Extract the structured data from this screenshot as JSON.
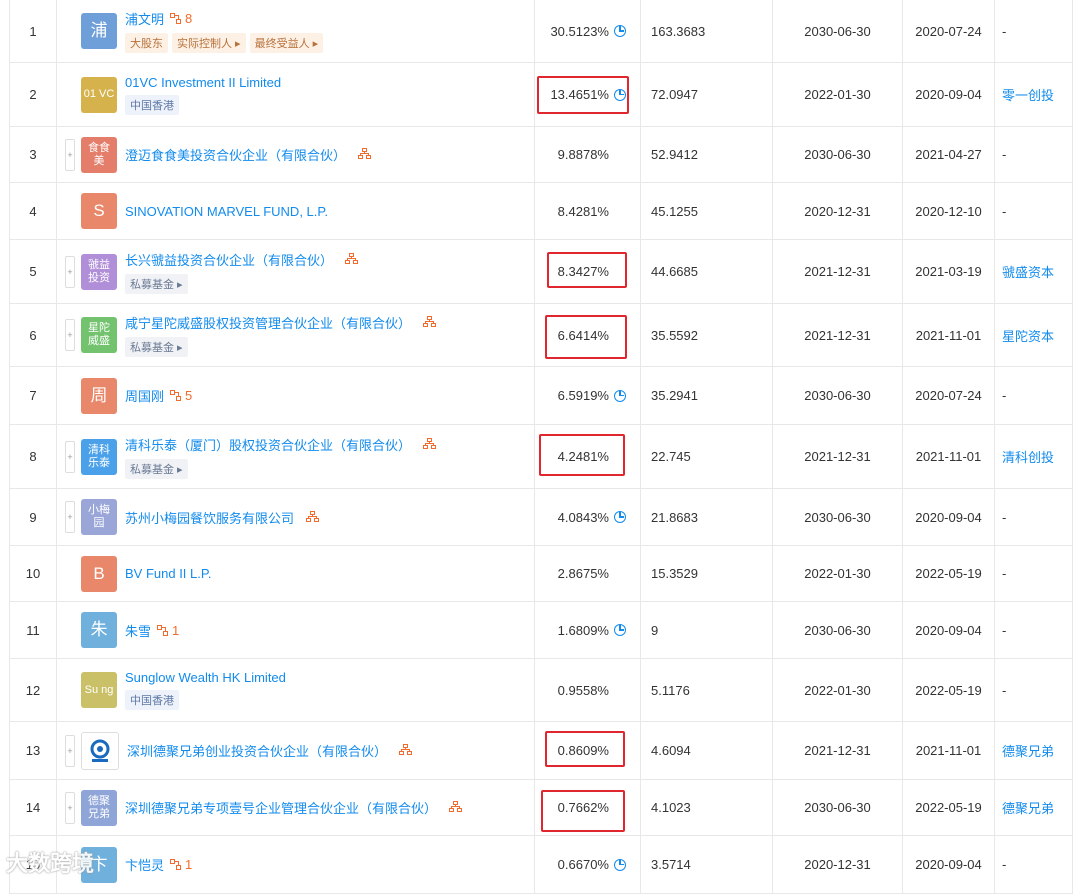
{
  "rows": [
    {
      "idx": "1",
      "logo": "浦",
      "logo_color": "#6f9fd8",
      "name": "浦文明",
      "count": "8",
      "tags": [
        {
          "t": "大股东",
          "c": "orange"
        },
        {
          "t": "实际控制人 ▸",
          "c": "orange"
        },
        {
          "t": "最终受益人 ▸",
          "c": "orange"
        }
      ],
      "pct": "30.5123%",
      "pie": true,
      "amt": "163.3683",
      "d1": "2030-06-30",
      "d2": "2020-07-24",
      "brand": "-",
      "expand": false,
      "tree": false,
      "hl": false
    },
    {
      "idx": "2",
      "logo": "01 VC",
      "logo_color": "#d6b24d",
      "name": "01VC Investment II Limited",
      "tags": [
        {
          "t": "中国香港",
          "c": "blue"
        }
      ],
      "pct": "13.4651%",
      "pie": true,
      "amt": "72.0947",
      "d1": "2022-01-30",
      "d2": "2020-09-04",
      "brand": "零一创投",
      "expand": false,
      "tree": false,
      "hl": true
    },
    {
      "idx": "3",
      "logo": "食食 美",
      "logo_color": "#e47d6a",
      "name": "澄迈食食美投资合伙企业（有限合伙）",
      "tags": [],
      "pct": "9.8878%",
      "pie": false,
      "amt": "52.9412",
      "d1": "2030-06-30",
      "d2": "2021-04-27",
      "brand": "-",
      "expand": true,
      "tree": true,
      "hl": false
    },
    {
      "idx": "4",
      "logo": "S",
      "logo_color": "#e8876a",
      "name": "SINOVATION MARVEL FUND, L.P.",
      "tags": [],
      "pct": "8.4281%",
      "pie": false,
      "amt": "45.1255",
      "d1": "2020-12-31",
      "d2": "2020-12-10",
      "brand": "-",
      "expand": false,
      "tree": false,
      "hl": false
    },
    {
      "idx": "5",
      "logo": "虢益 投资",
      "logo_color": "#b08fd8",
      "name": "长兴虢益投资合伙企业（有限合伙）",
      "tags": [
        {
          "t": "私募基金 ▸",
          "c": "gray"
        }
      ],
      "pct": "8.3427%",
      "pie": false,
      "amt": "44.6685",
      "d1": "2021-12-31",
      "d2": "2021-03-19",
      "brand": "虢盛资本",
      "expand": true,
      "tree": true,
      "hl": true
    },
    {
      "idx": "6",
      "logo": "星陀 威盛",
      "logo_color": "#72c26e",
      "name": "咸宁星陀威盛股权投资管理合伙企业（有限合伙）",
      "tags": [
        {
          "t": "私募基金 ▸",
          "c": "gray"
        }
      ],
      "pct": "6.6414%",
      "pie": false,
      "amt": "35.5592",
      "d1": "2021-12-31",
      "d2": "2021-11-01",
      "brand": "星陀资本",
      "expand": true,
      "tree": true,
      "hl": true
    },
    {
      "idx": "7",
      "logo": "周",
      "logo_color": "#e8876a",
      "name": "周国刚",
      "count": "5",
      "tags": [],
      "pct": "6.5919%",
      "pie": true,
      "amt": "35.2941",
      "d1": "2030-06-30",
      "d2": "2020-07-24",
      "brand": "-",
      "expand": false,
      "tree": false,
      "hl": false
    },
    {
      "idx": "8",
      "logo": "清科 乐泰",
      "logo_color": "#4aa1ea",
      "name": "清科乐泰（厦门）股权投资合伙企业（有限合伙）",
      "tags": [
        {
          "t": "私募基金 ▸",
          "c": "gray"
        }
      ],
      "pct": "4.2481%",
      "pie": false,
      "amt": "22.745",
      "d1": "2021-12-31",
      "d2": "2021-11-01",
      "brand": "清科创投",
      "expand": true,
      "tree": true,
      "hl": true
    },
    {
      "idx": "9",
      "logo": "小梅 园",
      "logo_color": "#9aa6d8",
      "name": "苏州小梅园餐饮服务有限公司",
      "tags": [],
      "pct": "4.0843%",
      "pie": true,
      "amt": "21.8683",
      "d1": "2030-06-30",
      "d2": "2020-09-04",
      "brand": "-",
      "expand": true,
      "tree": true,
      "hl": false
    },
    {
      "idx": "10",
      "logo": "B",
      "logo_color": "#e8876a",
      "name": "BV Fund II L.P.",
      "tags": [],
      "pct": "2.8675%",
      "pie": false,
      "amt": "15.3529",
      "d1": "2022-01-30",
      "d2": "2022-05-19",
      "brand": "-",
      "expand": false,
      "tree": false,
      "hl": false
    },
    {
      "idx": "11",
      "logo": "朱",
      "logo_color": "#6fb0dc",
      "name": "朱雪",
      "count": "1",
      "tags": [],
      "pct": "1.6809%",
      "pie": true,
      "amt": "9",
      "d1": "2030-06-30",
      "d2": "2020-09-04",
      "brand": "-",
      "expand": false,
      "tree": false,
      "hl": false
    },
    {
      "idx": "12",
      "logo": "Su ng",
      "logo_color": "#c9c067",
      "name": "Sunglow Wealth HK Limited",
      "tags": [
        {
          "t": "中国香港",
          "c": "blue"
        }
      ],
      "pct": "0.9558%",
      "pie": false,
      "amt": "5.1176",
      "d1": "2022-01-30",
      "d2": "2022-05-19",
      "brand": "-",
      "expand": false,
      "tree": false,
      "hl": false
    },
    {
      "idx": "13",
      "logo": "@",
      "logo_color": "#ffffff",
      "name": "深圳德聚兄弟创业投资合伙企业（有限合伙）",
      "tags": [],
      "pct": "0.8609%",
      "pie": false,
      "amt": "4.6094",
      "d1": "2021-12-31",
      "d2": "2021-11-01",
      "brand": "德聚兄弟",
      "expand": true,
      "tree": true,
      "hl": true
    },
    {
      "idx": "14",
      "logo": "德聚 兄弟",
      "logo_color": "#8fa5d8",
      "name": "深圳德聚兄弟专项壹号企业管理合伙企业（有限合伙）",
      "tags": [],
      "pct": "0.7662%",
      "pie": false,
      "amt": "4.1023",
      "d1": "2030-06-30",
      "d2": "2022-05-19",
      "brand": "德聚兄弟",
      "expand": true,
      "tree": true,
      "hl": true
    },
    {
      "idx": "15",
      "logo": "卞",
      "logo_color": "#6fb0dc",
      "name": "卞恺灵",
      "count": "1",
      "tags": [],
      "pct": "0.6670%",
      "pie": true,
      "amt": "3.5714",
      "d1": "2020-12-31",
      "d2": "2020-09-04",
      "brand": "-",
      "expand": false,
      "tree": false,
      "hl": false
    }
  ],
  "watermark": "大数跨境"
}
